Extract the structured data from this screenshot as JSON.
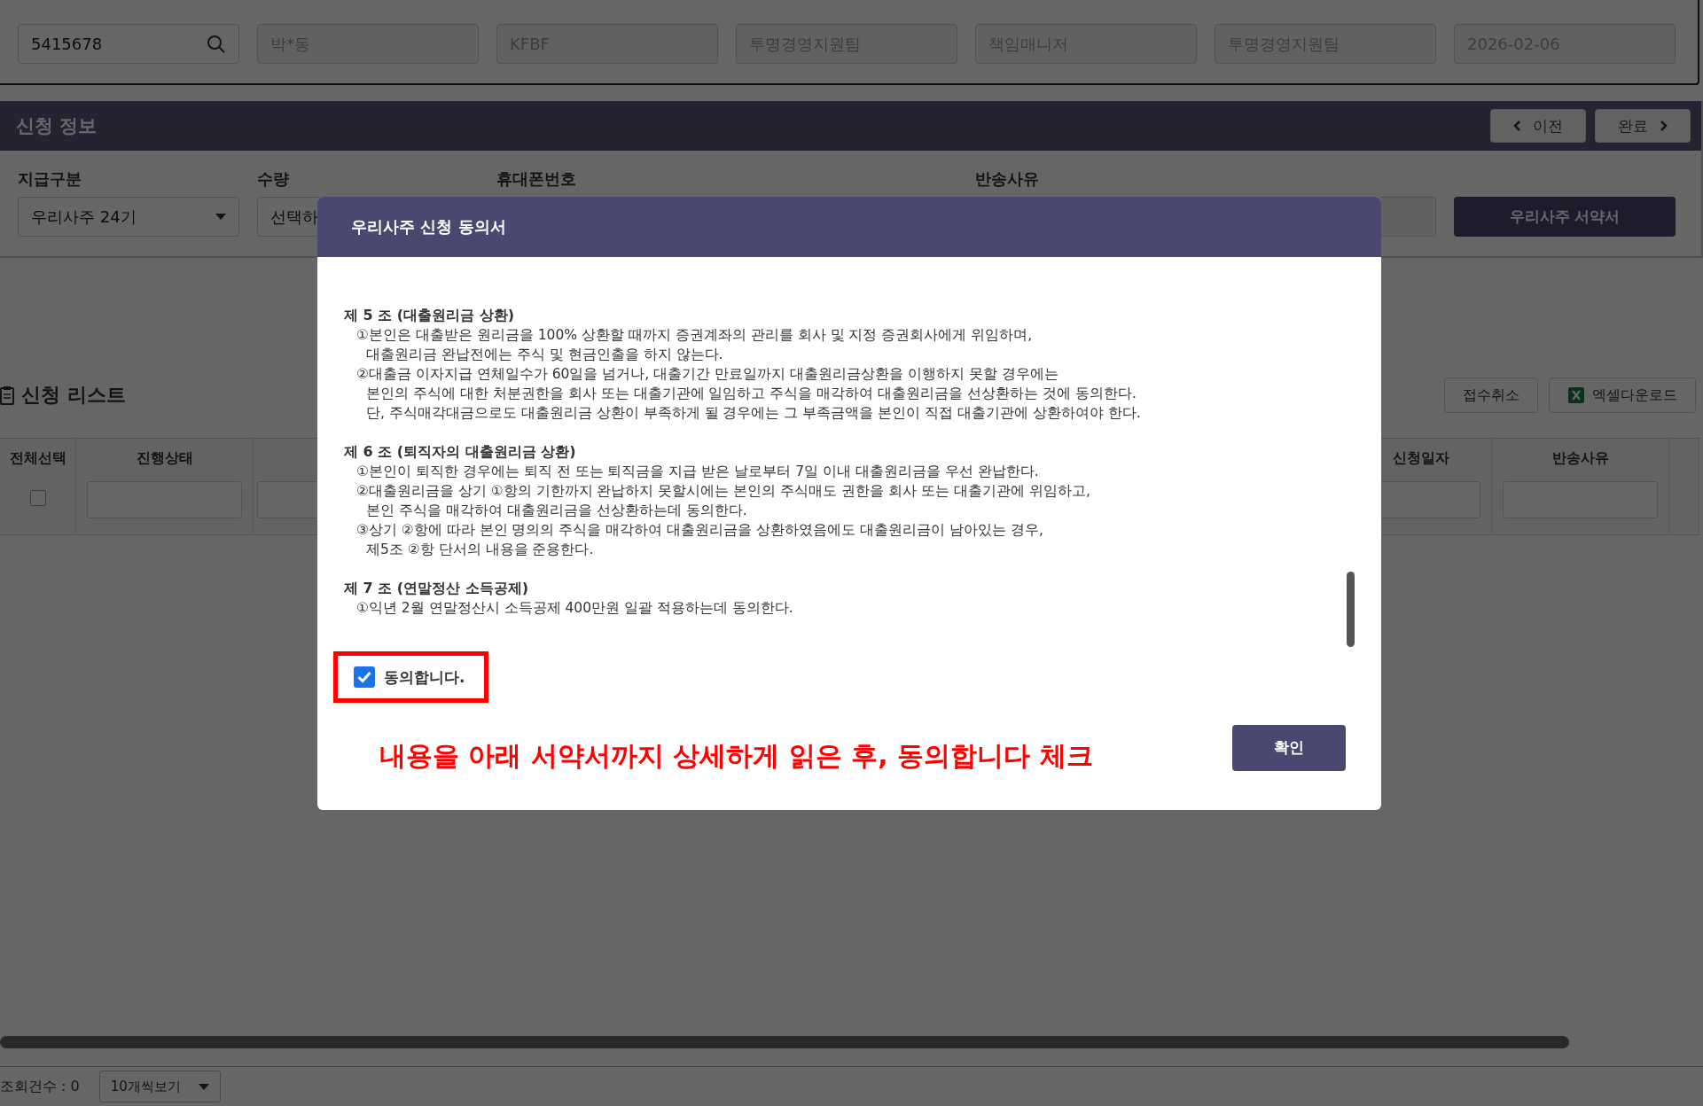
{
  "search_form": {
    "fields": [
      {
        "value": "5415678",
        "kind": "search"
      },
      {
        "value": "박*동",
        "kind": "readonly"
      },
      {
        "value": "KFBF",
        "kind": "readonly"
      },
      {
        "value": "투명경영지원팀",
        "kind": "readonly"
      },
      {
        "value": "책임매니저",
        "kind": "readonly"
      },
      {
        "value": "투명경영지원팀",
        "kind": "readonly"
      },
      {
        "value": "2026-02-06",
        "kind": "readonly"
      }
    ]
  },
  "application_info": {
    "title": "신청 정보",
    "nav_buttons": [
      {
        "label": "이전",
        "kind": "prev"
      },
      {
        "label": "완료",
        "kind": "next"
      }
    ],
    "fields": [
      {
        "label": "지급구분",
        "value": "우리사주 24기",
        "kind": "select"
      },
      {
        "label": "수량",
        "value": "선택하",
        "kind": "select"
      },
      {
        "label": "휴대폰번호",
        "kind": "text"
      },
      {
        "kind": "blank"
      },
      {
        "label": "반송사유",
        "kind": "wide"
      }
    ],
    "pledge_button": "우리사주 서약서"
  },
  "application_list": {
    "title": "신청 리스트",
    "buttons": [
      {
        "label": "접수취소",
        "kind": "plain"
      },
      {
        "label": "엑셀다운로드",
        "kind": "excel"
      }
    ],
    "columns": [
      {
        "label": "전체선택",
        "kind": "checkbox",
        "checked": false
      },
      {
        "label": "진행상태",
        "kind": "filter"
      },
      {
        "kind": "filter"
      },
      {
        "label": "신청일자",
        "kind": "filter"
      },
      {
        "label": "반송사유",
        "kind": "filter"
      },
      {
        "kind": "cut"
      }
    ]
  },
  "footer": {
    "count": "조회건수 : 0",
    "page_size": "10개씩보기"
  },
  "consent_dialog": {
    "title": "우리사주 신청 동의서",
    "sections": [
      {
        "heading": "제 5 조 (대출원리금 상환)",
        "items": [
          {
            "lines": [
              "①본인은 대출받은 원리금을 100% 상환할 때까지 증권계좌의 관리를 회사 및 지정 증권회사에게 위임하며,",
              "대출원리금 완납전에는 주식 및 현금인출을 하지 않는다."
            ]
          },
          {
            "lines": [
              "②대출금 이자지급 연체일수가 60일을 넘거나, 대출기간 만료일까지 대출원리금상환을 이행하지 못할 경우에는",
              "본인의 주식에 대한 처분권한을 회사 또는 대출기관에 일임하고 주식을 매각하여 대출원리금을 선상환하는 것에 동의한다.",
              "단, 주식매각대금으로도 대출원리금 상환이 부족하게 될 경우에는 그 부족금액을 본인이 직접 대출기관에 상환하여야 한다."
            ]
          }
        ]
      },
      {
        "heading": "제 6 조 (퇴직자의 대출원리금 상환)",
        "items": [
          {
            "lines": [
              "①본인이 퇴직한 경우에는 퇴직 전 또는 퇴직금을 지급 받은 날로부터 7일 이내 대출원리금을 우선 완납한다."
            ]
          },
          {
            "lines": [
              "②대출원리금을 상기 ①항의 기한까지 완납하지 못할시에는 본인의 주식매도 권한을 회사 또는 대출기관에 위임하고,",
              "본인 주식을 매각하여 대출원리금을 선상환하는데 동의한다."
            ]
          },
          {
            "lines": [
              "③상기 ②항에 따라 본인 명의의 주식을 매각하여 대출원리금을 상환하였음에도 대출원리금이 남아있는 경우,",
              "제5조 ②항 단서의 내용을 준용한다."
            ]
          }
        ]
      },
      {
        "heading": "제 7 조 (연말정산 소득공제)",
        "items": [
          {
            "lines": [
              "①익년 2월 연말정산시 소득공제 400만원 일괄 적용하는데 동의한다."
            ]
          }
        ]
      }
    ],
    "agree": {
      "label": "동의합니다.",
      "checked": true
    },
    "note": "내용을 아래 서약서까지 상세하게 읽은 후, 동의합니다 체크",
    "confirm_button": "확인"
  }
}
